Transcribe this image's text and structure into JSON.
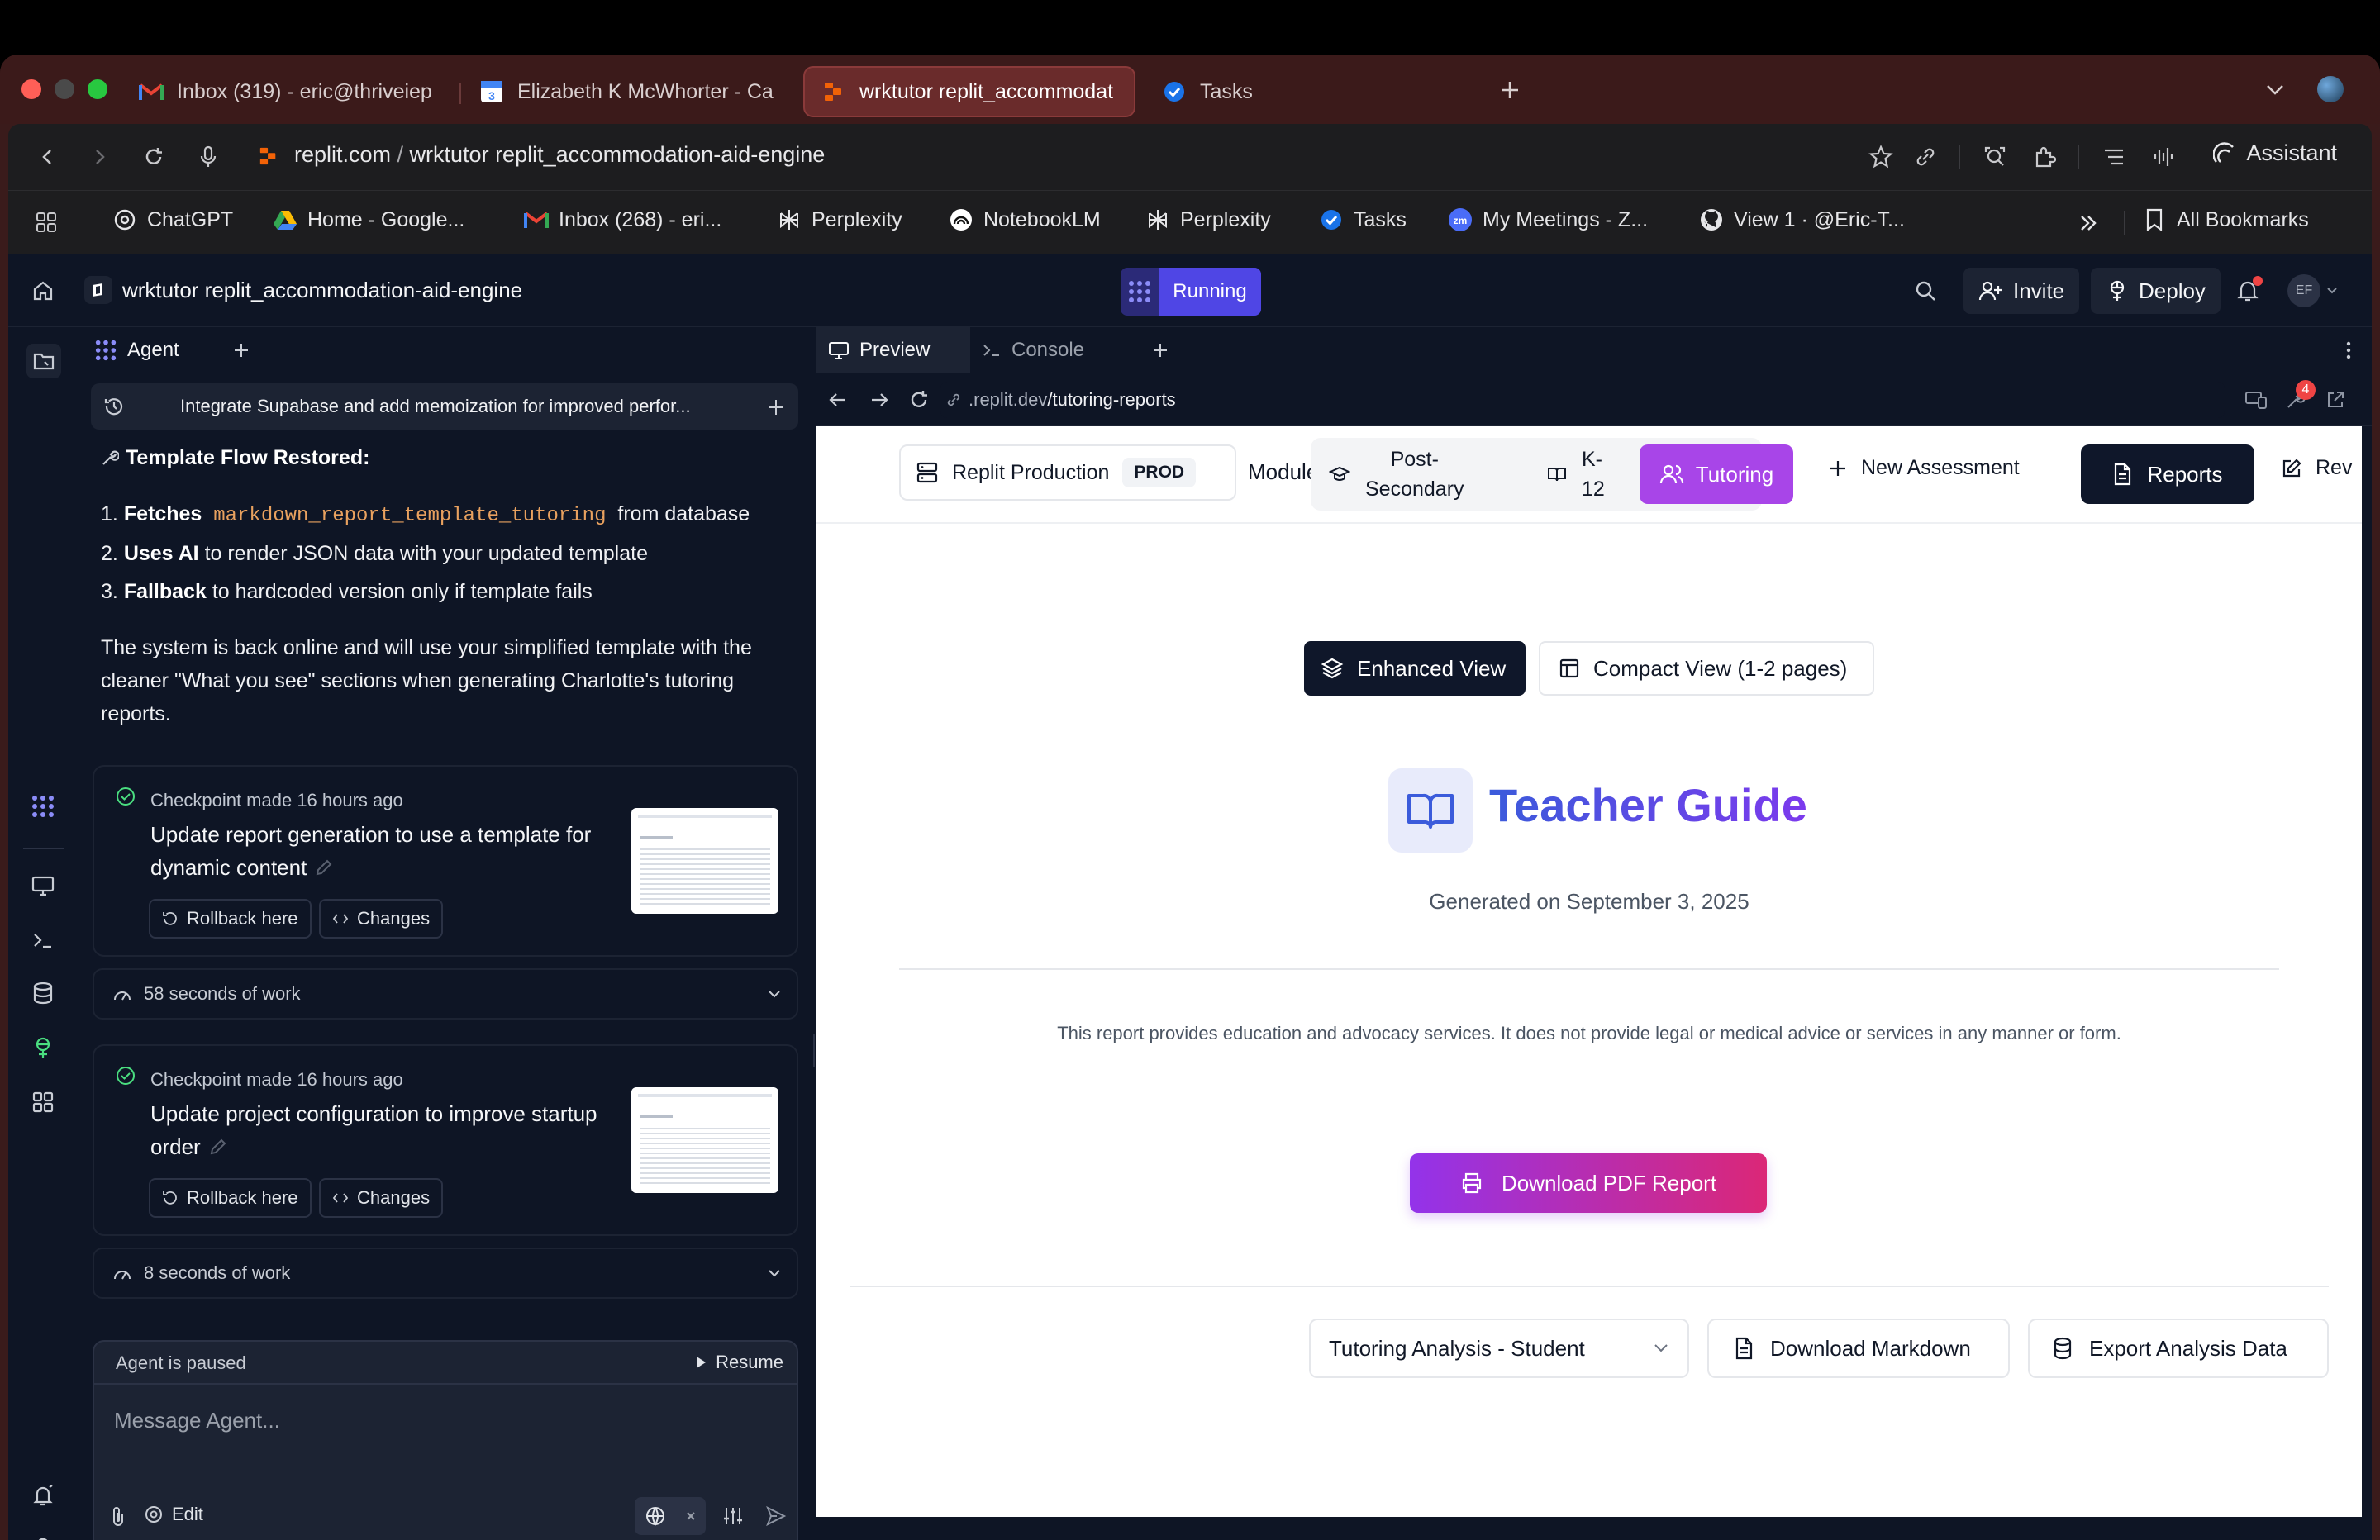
{
  "browser": {
    "tabs": [
      {
        "label": "Inbox (319) - eric@thriveiep",
        "icon": "gmail-icon"
      },
      {
        "label": "Elizabeth K McWhorter - Ca",
        "icon": "calendar-icon"
      },
      {
        "label": "wrktutor replit_accommodat",
        "icon": "replit-icon"
      },
      {
        "label": "Tasks",
        "icon": "tasks-icon"
      }
    ],
    "address": {
      "domain": "replit.com",
      "sep": " / ",
      "path": "wrktutor replit_accommodation-aid-engine"
    },
    "assistant_label": "Assistant",
    "bookmarks": [
      {
        "label": "ChatGPT",
        "icon": "chatgpt-icon"
      },
      {
        "label": "Home - Google...",
        "icon": "drive-icon"
      },
      {
        "label": "Inbox (268) - eri...",
        "icon": "gmail-icon"
      },
      {
        "label": "Perplexity",
        "icon": "perplexity-icon"
      },
      {
        "label": "NotebookLM",
        "icon": "notebooklm-icon"
      },
      {
        "label": "Perplexity",
        "icon": "perplexity-icon"
      },
      {
        "label": "Tasks",
        "icon": "tasks-icon"
      },
      {
        "label": "My Meetings - Z...",
        "icon": "zoom-icon"
      },
      {
        "label": "View 1 · @Eric-T...",
        "icon": "github-icon"
      }
    ],
    "all_bookmarks": "All Bookmarks"
  },
  "app": {
    "project_name": "wrktutor replit_accommodation-aid-engine",
    "run_status": "Running",
    "invite_label": "Invite",
    "deploy_label": "Deploy",
    "avatar_initials": "EF"
  },
  "agent": {
    "tab_label": "Agent",
    "session_title": "Integrate Supabase and add memoization for improved perfor...",
    "message": {
      "heading": "Template Flow Restored:",
      "items": [
        {
          "num": "1.",
          "bold": "Fetches",
          "code": "markdown_report_template_tutoring",
          "rest": "from database"
        },
        {
          "num": "2.",
          "bold": "Uses AI",
          "rest": "to render JSON data with your updated template"
        },
        {
          "num": "3.",
          "bold": "Fallback",
          "rest": "to hardcoded version only if template fails"
        }
      ],
      "para_lines": [
        "The system is back online and will use your simplified template with the",
        "cleaner \"What you see\" sections when generating Charlotte's tutoring",
        "reports."
      ]
    },
    "checkpoints": [
      {
        "meta": "Checkpoint made 16 hours ago",
        "title_lines": [
          "Update report generation to use a template for",
          "dynamic content"
        ],
        "rollback": "Rollback here",
        "changes": "Changes",
        "work": "58 seconds of work"
      },
      {
        "meta": "Checkpoint made 16 hours ago",
        "title_lines": [
          "Update project configuration to improve startup",
          "order"
        ],
        "rollback": "Rollback here",
        "changes": "Changes",
        "work": "8 seconds of work"
      }
    ],
    "paused_text": "Agent is paused",
    "resume_label": "Resume",
    "message_placeholder": "Message Agent...",
    "edit_label": "Edit"
  },
  "preview": {
    "tabs": [
      "Preview",
      "Console"
    ],
    "url_prefix": ".replit.dev",
    "url_path": "/tutoring-reports",
    "notif_count": "4",
    "topnav": {
      "env_label": "Replit Production",
      "env_badge": "PROD",
      "module_label": "Module:",
      "modules": [
        {
          "label_lines": [
            "Post-",
            "Secondary"
          ],
          "icon": "graduation-cap-icon"
        },
        {
          "label_lines": [
            "K-",
            "12"
          ],
          "icon": "book-open-icon"
        },
        {
          "label_lines": [
            "Tutoring"
          ],
          "icon": "users-icon"
        }
      ],
      "new_assessment": "New Assessment",
      "reports": "Reports",
      "review_partial": "Rev"
    },
    "view_toggle": {
      "enhanced": "Enhanced View",
      "compact": "Compact View (1-2 pages)"
    },
    "guide_title": "Teacher Guide",
    "generated_on": "Generated on September 3, 2025",
    "disclaimer": "This report provides education and advocacy services. It does not provide legal or medical advice or services in any manner or form.",
    "download_pdf": "Download PDF Report",
    "analysis_select": "Tutoring Analysis - Student",
    "download_markdown": "Download Markdown",
    "export_data": "Export Analysis Data"
  },
  "colors": {
    "accent_purple": "#7c3aed",
    "running_purple": "#4f46e5",
    "dark_button": "#0f172a",
    "gradient_from": "#9333ea",
    "gradient_to": "#db2777",
    "title_from": "#3b5bdb",
    "title_to": "#7c3aed"
  }
}
